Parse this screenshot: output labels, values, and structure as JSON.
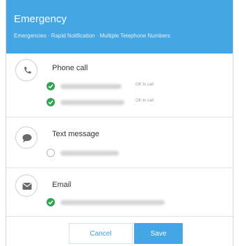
{
  "header": {
    "title": "Emergency",
    "breadcrumb": "Emergencies · Rapid Notification · Multiple Telephone Numbers"
  },
  "sections": [
    {
      "icon": "phone-icon",
      "label": "Phone call",
      "entries": [
        {
          "checked": true,
          "status": "OK to call"
        },
        {
          "checked": true,
          "status": "OK to call"
        }
      ]
    },
    {
      "icon": "chat-bubble-icon",
      "label": "Text message",
      "entries": [
        {
          "checked": false
        }
      ]
    },
    {
      "icon": "envelope-icon",
      "label": "Email",
      "entries": [
        {
          "checked": true
        }
      ]
    }
  ],
  "buttons": {
    "cancel": "Cancel",
    "save": "Save"
  },
  "colors": {
    "accent": "#45a6e4",
    "check": "#2ea44f"
  }
}
